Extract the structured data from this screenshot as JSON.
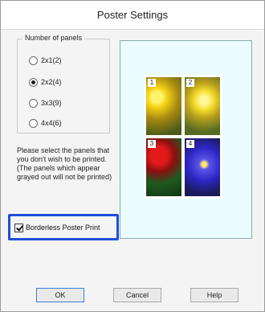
{
  "window": {
    "title": "Poster Settings"
  },
  "panels": {
    "legend": "Number of panels",
    "options": [
      {
        "label": "2x1(2)",
        "selected": false
      },
      {
        "label": "2x2(4)",
        "selected": true
      },
      {
        "label": "3x3(9)",
        "selected": false
      },
      {
        "label": "4x4(6)",
        "selected": false
      }
    ]
  },
  "instruction": "Please select the panels that you don't wish to be printed. (The panels which appear grayed out will not be printed)",
  "preview": {
    "panel_numbers": [
      "1",
      "2",
      "3",
      "4"
    ],
    "background_color": "#eafcfd"
  },
  "borderless": {
    "label": "Borderless Poster Print",
    "checked": true,
    "highlight_color": "#1e4fd6"
  },
  "buttons": {
    "ok": "OK",
    "cancel": "Cancel",
    "help": "Help"
  }
}
